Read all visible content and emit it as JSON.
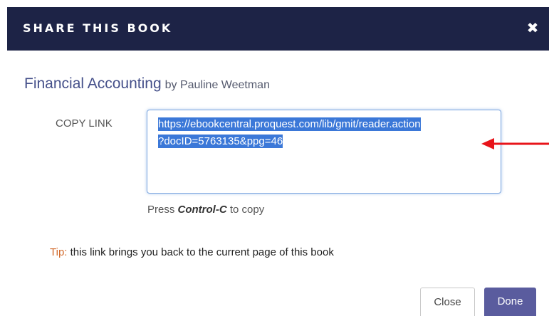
{
  "dialog": {
    "title": "SHARE THIS BOOK",
    "close_icon": "close-icon",
    "close_glyph": "✖"
  },
  "book": {
    "title": "Financial Accounting",
    "byline": "by Pauline Weetman"
  },
  "copy_link": {
    "label": "COPY LINK",
    "url_line1": "https://ebookcentral.proquest.com/lib/gmit/reader.action",
    "url_line2": "?docID=5763135&ppg=46",
    "selected": true
  },
  "hint": {
    "prefix": "Press ",
    "key": "Control-C",
    "suffix": " to copy"
  },
  "tip": {
    "label": "Tip:",
    "text": " this link brings you back to the current page of this book"
  },
  "buttons": {
    "close_label": "Close",
    "done_label": "Done"
  },
  "annotation": {
    "arrow_icon": "red-arrow-icon"
  },
  "colors": {
    "header_bg": "#1d2346",
    "accent": "#5a5c9e",
    "title_color": "#45508a",
    "selection": "#3b78d8",
    "tip_color": "#d2692a",
    "arrow_color": "#e8141a"
  }
}
